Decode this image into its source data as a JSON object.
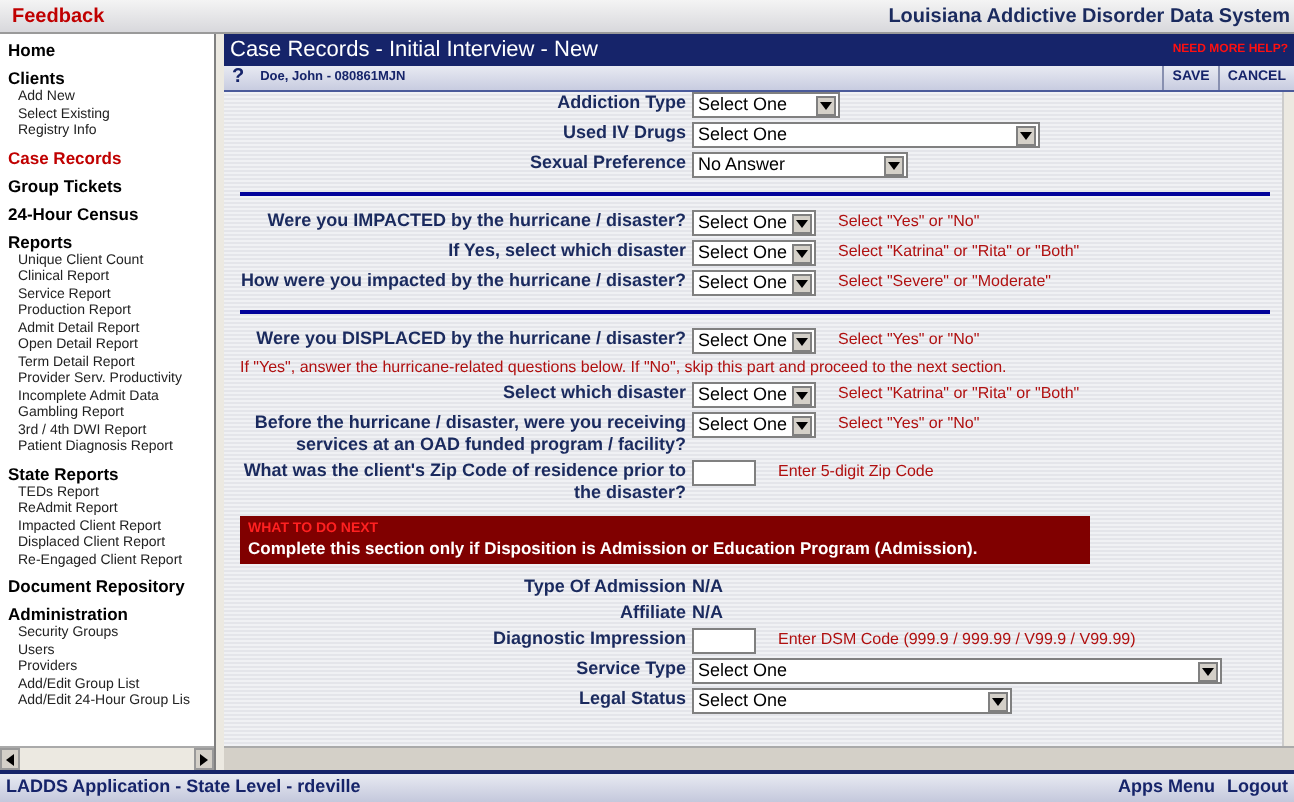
{
  "top_bar": {
    "feedback": "Feedback",
    "system_title": "Louisiana Addictive Disorder Data System"
  },
  "sidebar": {
    "groups": [
      {
        "label": "Home",
        "selected": false
      },
      {
        "label": "Clients",
        "selected": false,
        "items": [
          "Add New",
          "Select Existing",
          "Registry Info"
        ]
      },
      {
        "label": "Case Records",
        "selected": true
      },
      {
        "label": "Group Tickets",
        "selected": false
      },
      {
        "label": "24-Hour Census",
        "selected": false
      },
      {
        "label": "Reports",
        "selected": false,
        "items": [
          "Unique Client Count",
          "Clinical Report",
          "Service Report",
          "Production Report",
          "Admit Detail Report",
          "Open Detail Report",
          "Term Detail Report",
          "Provider Serv. Productivity",
          "Incomplete Admit Data",
          "Gambling Report",
          "3rd / 4th DWI Report",
          "Patient Diagnosis Report"
        ]
      },
      {
        "label": "State Reports",
        "selected": false,
        "items": [
          "TEDs Report",
          "ReAdmit Report",
          "Impacted Client Report",
          "Displaced Client Report",
          "Re-Engaged Client Report"
        ]
      },
      {
        "label": "Document Repository",
        "selected": false
      },
      {
        "label": "Administration",
        "selected": false,
        "items": [
          "Security Groups",
          "Users",
          "Providers",
          "Add/Edit Group List",
          "Add/Edit 24-Hour Group Lis"
        ]
      }
    ]
  },
  "header": {
    "title": "Case Records - Initial Interview - New",
    "help": "NEED MORE HELP?"
  },
  "subbar": {
    "help": "?",
    "client": "Doe, John - 080861MJN",
    "buttons": [
      "SAVE",
      "CANCEL"
    ]
  },
  "form": [
    {
      "kind": "select",
      "label": "Addiction Type",
      "value": "Select One"
    },
    {
      "kind": "select",
      "label": "Used IV Drugs",
      "value": "Select One"
    },
    {
      "kind": "select",
      "label": "Sexual Preference",
      "value": "No Answer"
    },
    {
      "kind": "divider"
    },
    {
      "kind": "select",
      "label": "Were you IMPACTED by the hurricane / disaster?",
      "value": "Select One",
      "hint": "Select \"Yes\" or \"No\""
    },
    {
      "kind": "select",
      "label": "If Yes, select which disaster",
      "value": "Select One",
      "hint": "Select \"Katrina\" or \"Rita\" or \"Both\""
    },
    {
      "kind": "select",
      "label": "How were you impacted by the hurricane / disaster?",
      "value": "Select One",
      "hint": "Select \"Severe\" or \"Moderate\""
    },
    {
      "kind": "divider"
    },
    {
      "kind": "select",
      "label": "Were you DISPLACED by the hurricane / disaster?",
      "value": "Select One",
      "hint": "Select \"Yes\" or \"No\""
    },
    {
      "kind": "note",
      "text": "If \"Yes\", answer the hurricane-related questions below. If \"No\", skip this part and proceed to the next section."
    },
    {
      "kind": "select",
      "label": "Select which disaster",
      "value": "Select One",
      "hint": "Select \"Katrina\" or \"Rita\" or \"Both\""
    },
    {
      "kind": "select",
      "label": "Before the hurricane / disaster, were you receiving services at an OAD funded program / facility?",
      "value": "Select One",
      "hint": "Select \"Yes\" or \"No\""
    },
    {
      "kind": "input",
      "label": "What was the client's Zip Code of residence prior to the disaster?",
      "hint": "Enter 5-digit Zip Code"
    },
    {
      "kind": "banner",
      "heading": "WHAT TO DO NEXT",
      "text": "Complete this section only if Disposition is Admission or Education Program (Admission)."
    },
    {
      "kind": "value",
      "label": "Type Of Admission",
      "value": "N/A"
    },
    {
      "kind": "value",
      "label": "Affiliate",
      "value": "N/A"
    },
    {
      "kind": "input",
      "label": "Diagnostic Impression",
      "hint": "Enter DSM Code (999.9 / 999.99 / V99.9 / V99.99)"
    },
    {
      "kind": "select",
      "label": "Service Type",
      "value": "Select One"
    },
    {
      "kind": "select",
      "label": "Legal Status",
      "value": "Select One"
    }
  ],
  "footer": {
    "app": "LADDS Application - State Level - rdeville",
    "links": [
      "Apps Menu",
      "Logout"
    ]
  }
}
